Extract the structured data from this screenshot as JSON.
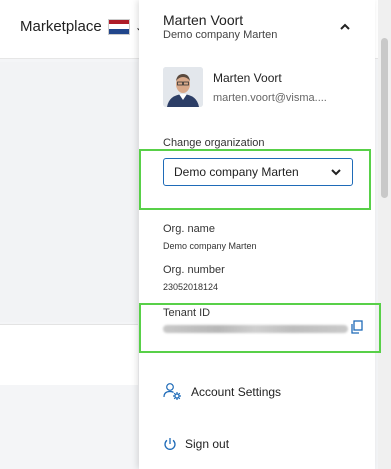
{
  "topbar": {
    "marketplace_label": "Marketplace",
    "flag_icon": "netherlands-flag-icon",
    "flag_colors": [
      "#ae1c28",
      "#ffffff",
      "#21468b"
    ]
  },
  "account_menu": {
    "header": {
      "user_name": "Marten Voort",
      "organization": "Demo company Marten"
    },
    "profile": {
      "name": "Marten Voort",
      "email": "marten.voort@visma...."
    },
    "change_organization": {
      "label": "Change organization",
      "selected": "Demo company Marten"
    },
    "org_name": {
      "label": "Org. name",
      "value": "Demo company Marten"
    },
    "org_number": {
      "label": "Org. number",
      "value": "23052018124"
    },
    "tenant_id": {
      "label": "Tenant ID"
    },
    "account_settings_label": "Account Settings",
    "sign_out_label": "Sign out"
  },
  "colors": {
    "highlight": "#58d048",
    "accent": "#1f6bb8"
  }
}
